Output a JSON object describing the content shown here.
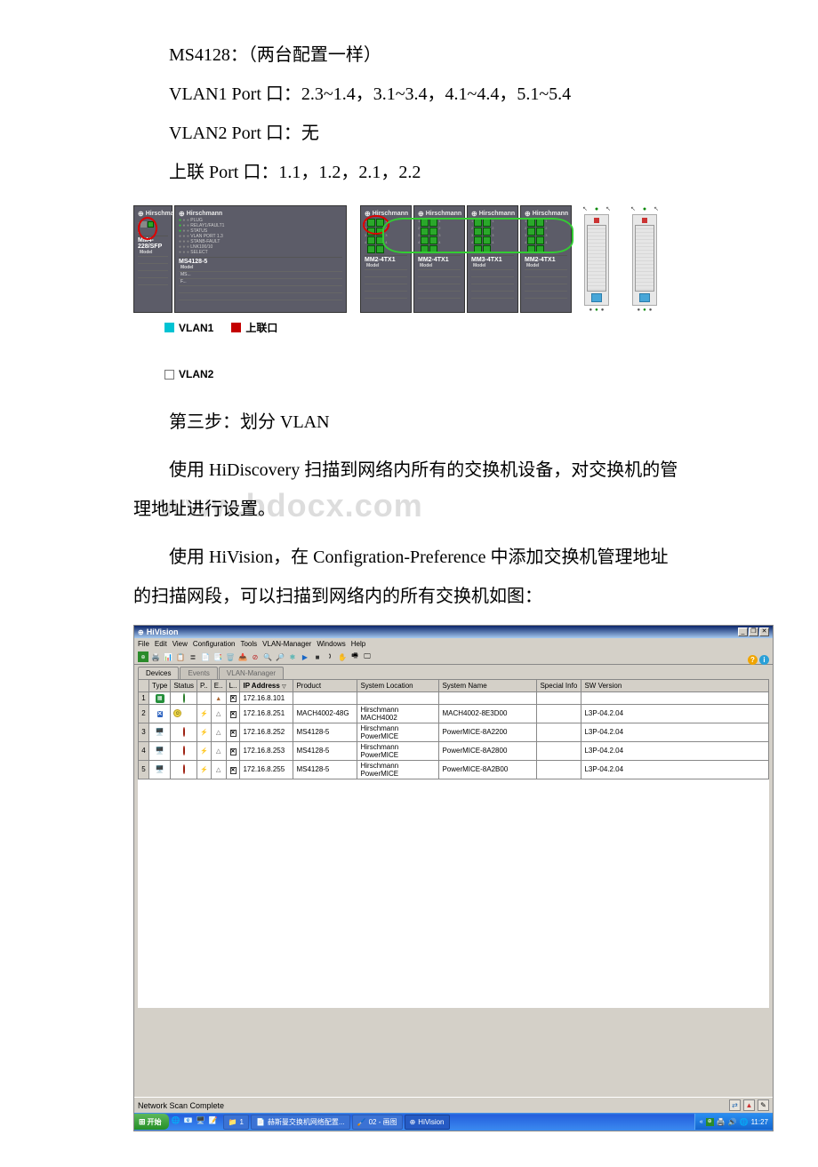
{
  "text": {
    "line1": "MS4128：（两台配置一样）",
    "line2": "VLAN1 Port 口：2.3~1.4，3.1~3.4，4.1~4.4，5.1~5.4",
    "line3": "VLAN2 Port 口：无",
    "line4": "上联 Port 口：1.1，1.2，2.1，2.2",
    "step3": "第三步：划分 VLAN",
    "p1": "使用 HiDiscovery 扫描到网络内所有的交换机设备，对交换机的管理地址进行设置。",
    "p2": "使用 HiVision，在 Configration-Preference 中添加交换机管理地址的扫描网段，可以扫描到网络内的所有交换机如图："
  },
  "watermark": "www.bdocx.com",
  "legend": {
    "vlan1": "VLAN1",
    "vlan2": "VLAN2",
    "uplink": "上联口"
  },
  "devices": {
    "brand": "Hirschmann",
    "left1": "MM4-228/SFP",
    "left2": "MS4128-5",
    "small_lines": [
      "PLUG",
      "RELAY1/FAULT1",
      "STATUS",
      "VLAN PORT 1.3",
      "STANB-FAULT",
      "LNK100/10",
      "SELECT"
    ],
    "right_labels": [
      "MM2-4TX1",
      "MM2-4TX1",
      "MM3-4TX1",
      "MM2-4TX1"
    ],
    "row_hdr": "Model",
    "left2_rows": [
      "MS...",
      "F..."
    ]
  },
  "app": {
    "title": "HiVision",
    "menu": [
      "File",
      "Edit",
      "View",
      "Configuration",
      "Tools",
      "VLAN-Manager",
      "Windows",
      "Help"
    ],
    "tabs": [
      "Devices",
      "Events",
      "VLAN-Manager"
    ],
    "cols": [
      "",
      "Type",
      "Status",
      "P..",
      "E..",
      "L..",
      "IP Address",
      "Product",
      "System Location",
      "System Name",
      "Special Info",
      "SW Version"
    ],
    "rows": [
      {
        "n": "1",
        "type": "new",
        "status": "green",
        "ip": "172.16.8.101",
        "product": "",
        "loc": "",
        "name": "",
        "info": "",
        "ver": ""
      },
      {
        "n": "2",
        "type": "x",
        "status": "yellow",
        "ip": "172.16.8.251",
        "product": "MACH4002-48G",
        "loc": "Hirschmann MACH4002",
        "name": "MACH4002-8E3D00",
        "info": "",
        "ver": "L3P-04.2.04"
      },
      {
        "n": "3",
        "type": "screen",
        "status": "red",
        "ip": "172.16.8.252",
        "product": "MS4128-5",
        "loc": "Hirschmann PowerMICE",
        "name": "PowerMICE-8A2200",
        "info": "",
        "ver": "L3P-04.2.04"
      },
      {
        "n": "4",
        "type": "screen",
        "status": "red",
        "ip": "172.16.8.253",
        "product": "MS4128-5",
        "loc": "Hirschmann PowerMICE",
        "name": "PowerMICE-8A2800",
        "info": "",
        "ver": "L3P-04.2.04"
      },
      {
        "n": "5",
        "type": "screen",
        "status": "red",
        "ip": "172.16.8.255",
        "product": "MS4128-5",
        "loc": "Hirschmann PowerMICE",
        "name": "PowerMICE-8A2B00",
        "info": "",
        "ver": "L3P-04.2.04"
      }
    ],
    "status_text": "Network Scan Complete"
  },
  "taskbar": {
    "start": "开始",
    "items": [
      {
        "icon": "📁",
        "label": "1"
      },
      {
        "icon": "📄",
        "label": "赫斯曼交换机网络配置..."
      },
      {
        "icon": "🖌️",
        "label": "02 - 画图"
      },
      {
        "icon": "⊕",
        "label": "HiVision"
      }
    ],
    "time": "11:27"
  }
}
